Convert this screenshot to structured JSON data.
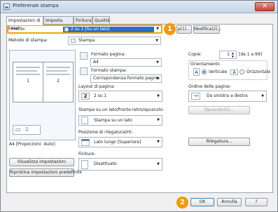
{
  "window": {
    "title": "Preferenze stampa",
    "close_symbol": "✕"
  },
  "tabs": [
    {
      "label": "Impostazioni di base"
    },
    {
      "label": "Imposta pagina"
    },
    {
      "label": "Finitura"
    },
    {
      "label": "Qualità"
    }
  ],
  "profile": {
    "label": "Profilo:",
    "selected": "2 su 1 [Su un lato]",
    "badge": "1",
    "edit_partial_label": "p(1)...",
    "modify_label": "Modifica(2)..."
  },
  "print_method": {
    "label": "Metodo di stampa:",
    "value": "Stampa"
  },
  "preview": {
    "page_numbers": [
      "1",
      "2"
    ],
    "caption": "A4 [Proporzioni: Auto]"
  },
  "left_buttons": {
    "view_settings": "Visualizza impostazioni",
    "restore_defaults": "Ripristina impostazioni predefinite"
  },
  "page_format": {
    "label": "Formato pagina:",
    "value": "A4"
  },
  "print_format": {
    "label": "Formato stampa:",
    "value": "Corrispondenza formato pagina"
  },
  "layout": {
    "label": "Layout di pagina:",
    "value": "2 su 1",
    "icon_text": "2"
  },
  "duplex": {
    "label": "Stampa su un lato/fronte-retro/opuscolo:",
    "value": "Stampa su un lato"
  },
  "binding": {
    "label": "Posizione di rilegatura(H):",
    "value": "Lato lungo [Superiore]",
    "button": "Rilegatura..."
  },
  "finishing": {
    "label": "Finiture:",
    "value": "Disattivato"
  },
  "copies": {
    "label": "Copie:",
    "value": "1",
    "range": "[da 1 a 99]"
  },
  "orientation": {
    "label": "Orientamento",
    "vertical": "Verticale",
    "horizontal": "Orizzontale",
    "selected": "Verticale"
  },
  "page_order": {
    "label": "Ordine delle pagine:",
    "value": "Da sinistra a destra"
  },
  "booklet_button": "Opuscolo(G)...",
  "footer": {
    "ok": "OK",
    "cancel": "Annulla",
    "help": "?",
    "badge": "2"
  },
  "colors": {
    "accent_badge": "#f39a00",
    "selection": "#2d6ccd"
  }
}
